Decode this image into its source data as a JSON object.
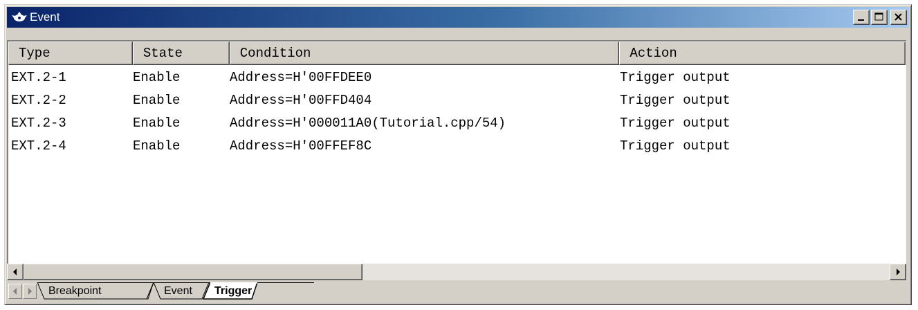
{
  "window": {
    "title": "Event",
    "title_icon": "event-icon",
    "buttons": [
      "minimize-icon",
      "maximize-icon",
      "close-icon"
    ]
  },
  "table": {
    "columns": [
      "Type",
      "State",
      "Condition",
      "Action"
    ],
    "rows": [
      [
        "EXT.2-1",
        "Enable",
        "Address=H'00FFDEE0",
        "Trigger output"
      ],
      [
        "EXT.2-2",
        "Enable",
        "Address=H'00FFD404",
        "Trigger output"
      ],
      [
        "EXT.2-3",
        "Enable",
        "Address=H'000011A0(Tutorial.cpp/54)",
        "Trigger output"
      ],
      [
        "EXT.2-4",
        "Enable",
        "Address=H'00FFEF8C",
        "Trigger output"
      ]
    ]
  },
  "tabs": {
    "items": [
      "Breakpoint",
      "Event",
      "Trigger"
    ],
    "active": "Trigger"
  },
  "colors": {
    "title_start": "#0a246a",
    "title_end": "#a6caf0",
    "face": "#d4d0c8"
  }
}
